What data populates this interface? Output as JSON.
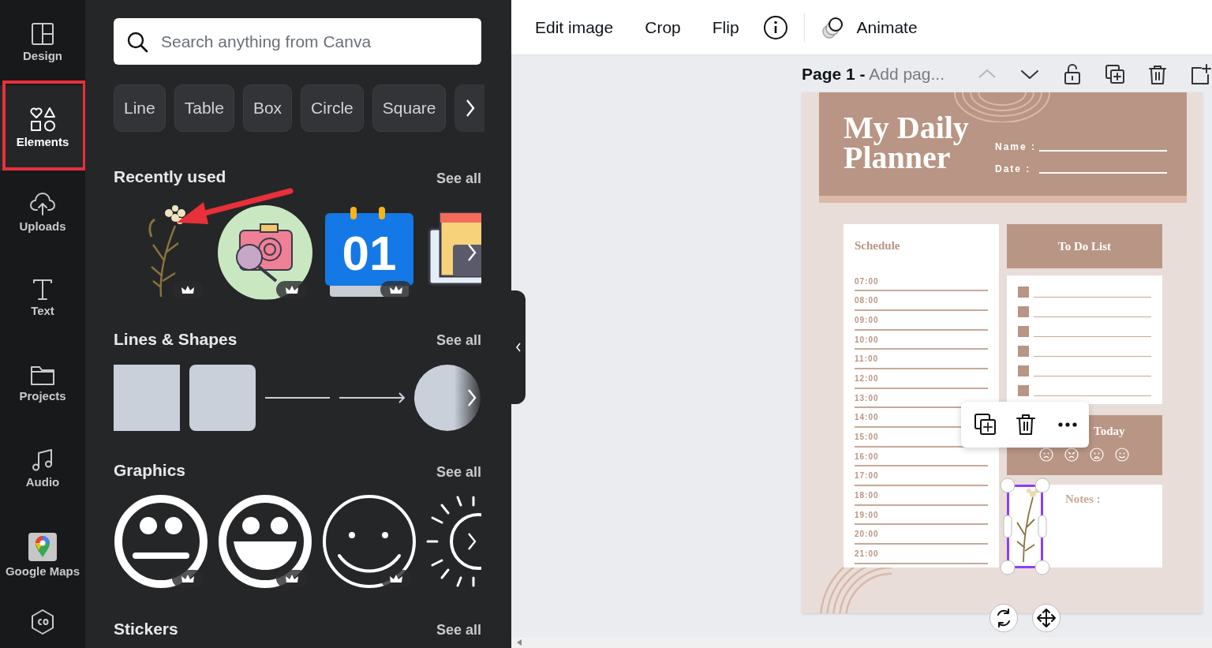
{
  "sidebar": {
    "items": [
      {
        "kind": "design",
        "label": "Design",
        "selected": false,
        "highlighted": false
      },
      {
        "kind": "elements",
        "label": "Elements",
        "selected": true,
        "highlighted": true
      },
      {
        "kind": "uploads",
        "label": "Uploads",
        "selected": false,
        "highlighted": false
      },
      {
        "kind": "text",
        "label": "Text",
        "selected": false,
        "highlighted": false
      },
      {
        "kind": "projects",
        "label": "Projects",
        "selected": false,
        "highlighted": false
      },
      {
        "kind": "audio",
        "label": "Audio",
        "selected": false,
        "highlighted": false
      },
      {
        "kind": "maps",
        "label": "Google Maps",
        "selected": false,
        "highlighted": false
      },
      {
        "kind": "co",
        "selected": false,
        "highlighted": false
      }
    ]
  },
  "elements_panel": {
    "search": {
      "placeholder": "Search anything from Canva"
    },
    "chips": [
      "Line",
      "Table",
      "Box",
      "Circle",
      "Square"
    ],
    "sections": [
      {
        "title": "Recently used",
        "link": "See all",
        "items": [
          {
            "kind": "flower",
            "premium": true,
            "pointed": true
          },
          {
            "kind": "camera",
            "premium": true,
            "pointed": false
          },
          {
            "kind": "calendar",
            "label": "01",
            "premium": true,
            "pointed": false
          },
          {
            "kind": "app",
            "premium": false,
            "pointed": false
          }
        ]
      },
      {
        "title": "Lines & Shapes",
        "link": "See all",
        "items": [
          {
            "kind": "square",
            "premium": false,
            "pointed": false
          },
          {
            "kind": "rounded-square",
            "premium": false,
            "pointed": false
          },
          {
            "kind": "line",
            "premium": false,
            "pointed": false
          },
          {
            "kind": "arrow",
            "premium": false,
            "pointed": false
          },
          {
            "kind": "circle",
            "premium": false,
            "pointed": false
          }
        ]
      },
      {
        "title": "Graphics",
        "link": "See all",
        "items": [
          {
            "kind": "neutral-face",
            "premium": true,
            "pointed": false
          },
          {
            "kind": "grin-face",
            "premium": true,
            "pointed": false
          },
          {
            "kind": "smile-face",
            "premium": true,
            "pointed": false
          },
          {
            "kind": "sun",
            "premium": false,
            "pointed": false
          }
        ]
      },
      {
        "title": "Stickers",
        "link": "See all"
      }
    ]
  },
  "toolbar": {
    "buttons": [
      "Edit image",
      "Crop",
      "Flip"
    ],
    "animate": "Animate"
  },
  "page_bar": {
    "page": "Page 1 -",
    "title": "Add pag..."
  },
  "planner": {
    "title": "My Daily Planner",
    "fields": [
      "Name :",
      "Date :"
    ],
    "schedule": {
      "title": "Schedule",
      "times": [
        "07:00",
        "08:00",
        "09:00",
        "10:00",
        "11:00",
        "12:00",
        "13:00",
        "14:00",
        "15:00",
        "16:00",
        "17:00",
        "18:00",
        "19:00",
        "20:00",
        "21:00"
      ]
    },
    "todo": {
      "title": "To Do List"
    },
    "mood": {
      "title": "Today"
    },
    "notes": {
      "title": "Notes :"
    }
  }
}
